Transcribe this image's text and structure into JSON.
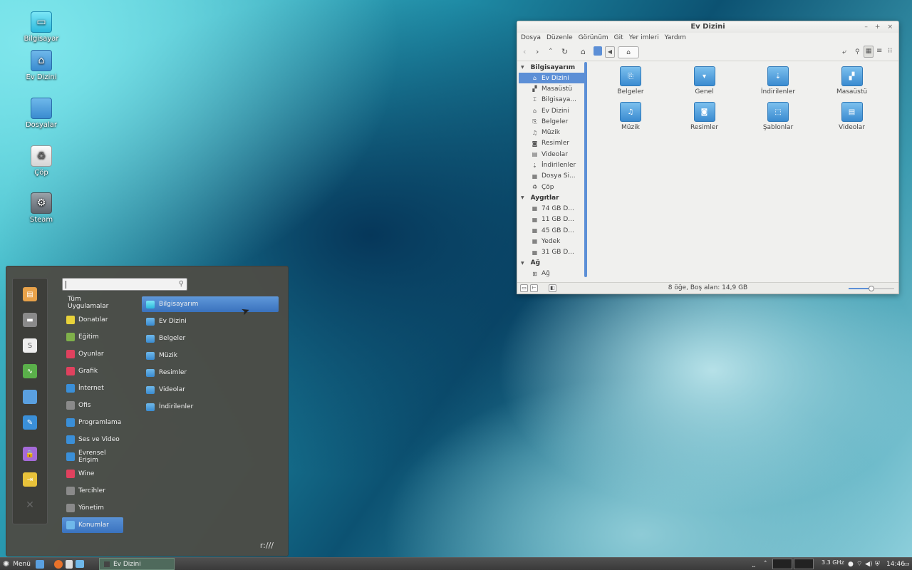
{
  "desktop": {
    "icons": [
      {
        "label": "Bilgisayar",
        "icon": "computer-icon"
      },
      {
        "label": "Ev Dizini",
        "icon": "home-folder-icon"
      },
      {
        "label": "Dosyalar",
        "icon": "folder-icon"
      },
      {
        "label": "Çöp",
        "icon": "trash-icon"
      },
      {
        "label": "Steam",
        "icon": "steam-icon"
      }
    ]
  },
  "menu": {
    "search": {
      "value": "",
      "placeholder": ""
    },
    "favorites": [
      "archive-icon",
      "drive-icon",
      "text-editor-icon",
      "system-monitor-icon",
      "files-icon",
      "notes-icon",
      "lock-icon",
      "logout-icon",
      "quit-icon"
    ],
    "categories": [
      {
        "label": "Tüm Uygulamalar",
        "color": ""
      },
      {
        "label": "Donatılar",
        "color": "#e8d23a"
      },
      {
        "label": "Eğitim",
        "color": "#7fb04a"
      },
      {
        "label": "Oyunlar",
        "color": "#e0415e"
      },
      {
        "label": "Grafik",
        "color": "#e0415e"
      },
      {
        "label": "İnternet",
        "color": "#3a8fd8"
      },
      {
        "label": "Ofis",
        "color": "#8a8a8a"
      },
      {
        "label": "Programlama",
        "color": "#3a8fd8"
      },
      {
        "label": "Ses ve Video",
        "color": "#3a8fd8"
      },
      {
        "label": "Evrensel Erişim",
        "color": "#3a8fd8"
      },
      {
        "label": "Wine",
        "color": "#e0415e"
      },
      {
        "label": "Tercihler",
        "color": "#8a8a8a"
      },
      {
        "label": "Yönetim",
        "color": "#8a8a8a"
      },
      {
        "label": "Konumlar",
        "color": "#6fb8ea"
      }
    ],
    "selected_category": "Konumlar",
    "places": [
      "Bilgisayarım",
      "Ev Dizini",
      "Belgeler",
      "Müzik",
      "Resimler",
      "Videolar",
      "İndirilenler"
    ],
    "selected_place": "Bilgisayarım",
    "footer": "r:///"
  },
  "file_manager": {
    "title": "Ev Dizini",
    "window_controls": [
      "–",
      "+",
      "×"
    ],
    "menubar": [
      "Dosya",
      "Düzenle",
      "Görünüm",
      "Git",
      "Yer imleri",
      "Yardım"
    ],
    "sidebar": {
      "sections": [
        {
          "header": "Bilgisayarım",
          "items": [
            {
              "label": "Ev Dizini",
              "icon": "⌂",
              "selected": true
            },
            {
              "label": "Masaüstü",
              "icon": "▞"
            },
            {
              "label": "Bilgisaya...",
              "icon": "⌶"
            },
            {
              "label": "Ev Dizini",
              "icon": "⌂"
            },
            {
              "label": "Belgeler",
              "icon": "⎘"
            },
            {
              "label": "Müzik",
              "icon": "♫"
            },
            {
              "label": "Resimler",
              "icon": "◙"
            },
            {
              "label": "Videolar",
              "icon": "▤"
            },
            {
              "label": "İndirilenler",
              "icon": "⇣"
            },
            {
              "label": "Dosya Si...",
              "icon": "▦"
            },
            {
              "label": "Çöp",
              "icon": "♻"
            }
          ]
        },
        {
          "header": "Aygıtlar",
          "items": [
            {
              "label": "74 GB D...",
              "icon": "▦"
            },
            {
              "label": "11 GB D...",
              "icon": "▦"
            },
            {
              "label": "45 GB D...",
              "icon": "▦"
            },
            {
              "label": "Yedek",
              "icon": "▦"
            },
            {
              "label": "31 GB D...",
              "icon": "▦"
            }
          ]
        },
        {
          "header": "Ağ",
          "items": [
            {
              "label": "Ağ",
              "icon": "⊞"
            }
          ]
        }
      ]
    },
    "files": [
      {
        "label": "Belgeler",
        "glyph": "⎘"
      },
      {
        "label": "Genel",
        "glyph": "▾"
      },
      {
        "label": "İndirilenler",
        "glyph": "⇣"
      },
      {
        "label": "Masaüstü",
        "glyph": "▞"
      },
      {
        "label": "Müzik",
        "glyph": "♫"
      },
      {
        "label": "Resimler",
        "glyph": "◙"
      },
      {
        "label": "Şablonlar",
        "glyph": "⬚"
      },
      {
        "label": "Videolar",
        "glyph": "▤"
      }
    ],
    "status": "8 öğe, Boş alan: 14,9 GB",
    "zoom_fraction": 0.5
  },
  "panel": {
    "menu_label": "Menü",
    "task_label": "Ev Dizini",
    "cpu": "3.3 GHz",
    "clock": "14:46"
  }
}
